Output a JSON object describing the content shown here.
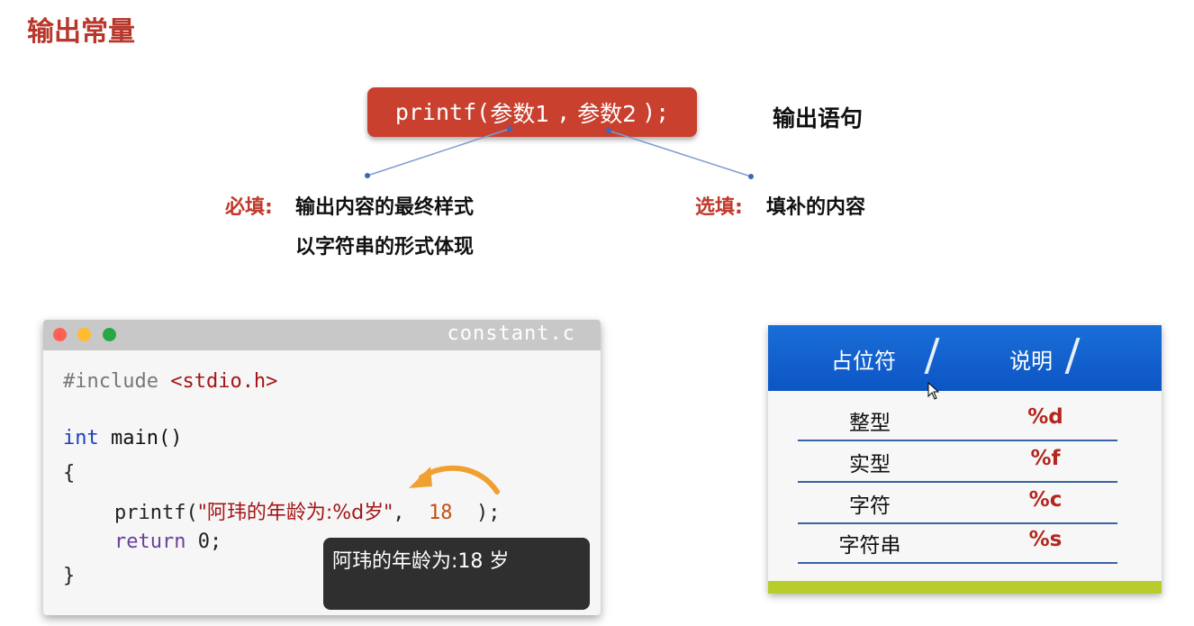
{
  "title": "输出常量",
  "func": {
    "call_prefix": "printf(",
    "param1": "参数1",
    "sep": ",",
    "param2": "参数2",
    "call_suffix": ");"
  },
  "output_label": "输出语句",
  "required": {
    "label": "必填:",
    "line1": "输出内容的最终样式",
    "line2": "以字符串的形式体现"
  },
  "optional": {
    "label": "选填:",
    "text": "填补的内容"
  },
  "code": {
    "filename": "constant.c",
    "include_directive": "#include",
    "include_header": "<stdio.h>",
    "kw_int": "int",
    "main_sig": "main()",
    "open_brace": "{",
    "printf_open": "printf(",
    "string_literal": "\"阿玮的年龄为:%d岁\"",
    "comma": ",",
    "arg": "18",
    "printf_close": ");",
    "kw_return": "return",
    "return_value": "0;",
    "close_brace": "}"
  },
  "console_output": "阿玮的年龄为:18 岁",
  "table": {
    "header_type": "占位符",
    "header_desc": "说明",
    "rows": [
      {
        "type": "整型",
        "fmt": "%d"
      },
      {
        "type": "实型",
        "fmt": "%f"
      },
      {
        "type": "字符",
        "fmt": "%c"
      },
      {
        "type": "字符串",
        "fmt": "%s"
      }
    ]
  },
  "colors": {
    "accent_red": "#c9402f",
    "table_blue": "#0c55c4",
    "footer_green": "#b8cc2c"
  }
}
